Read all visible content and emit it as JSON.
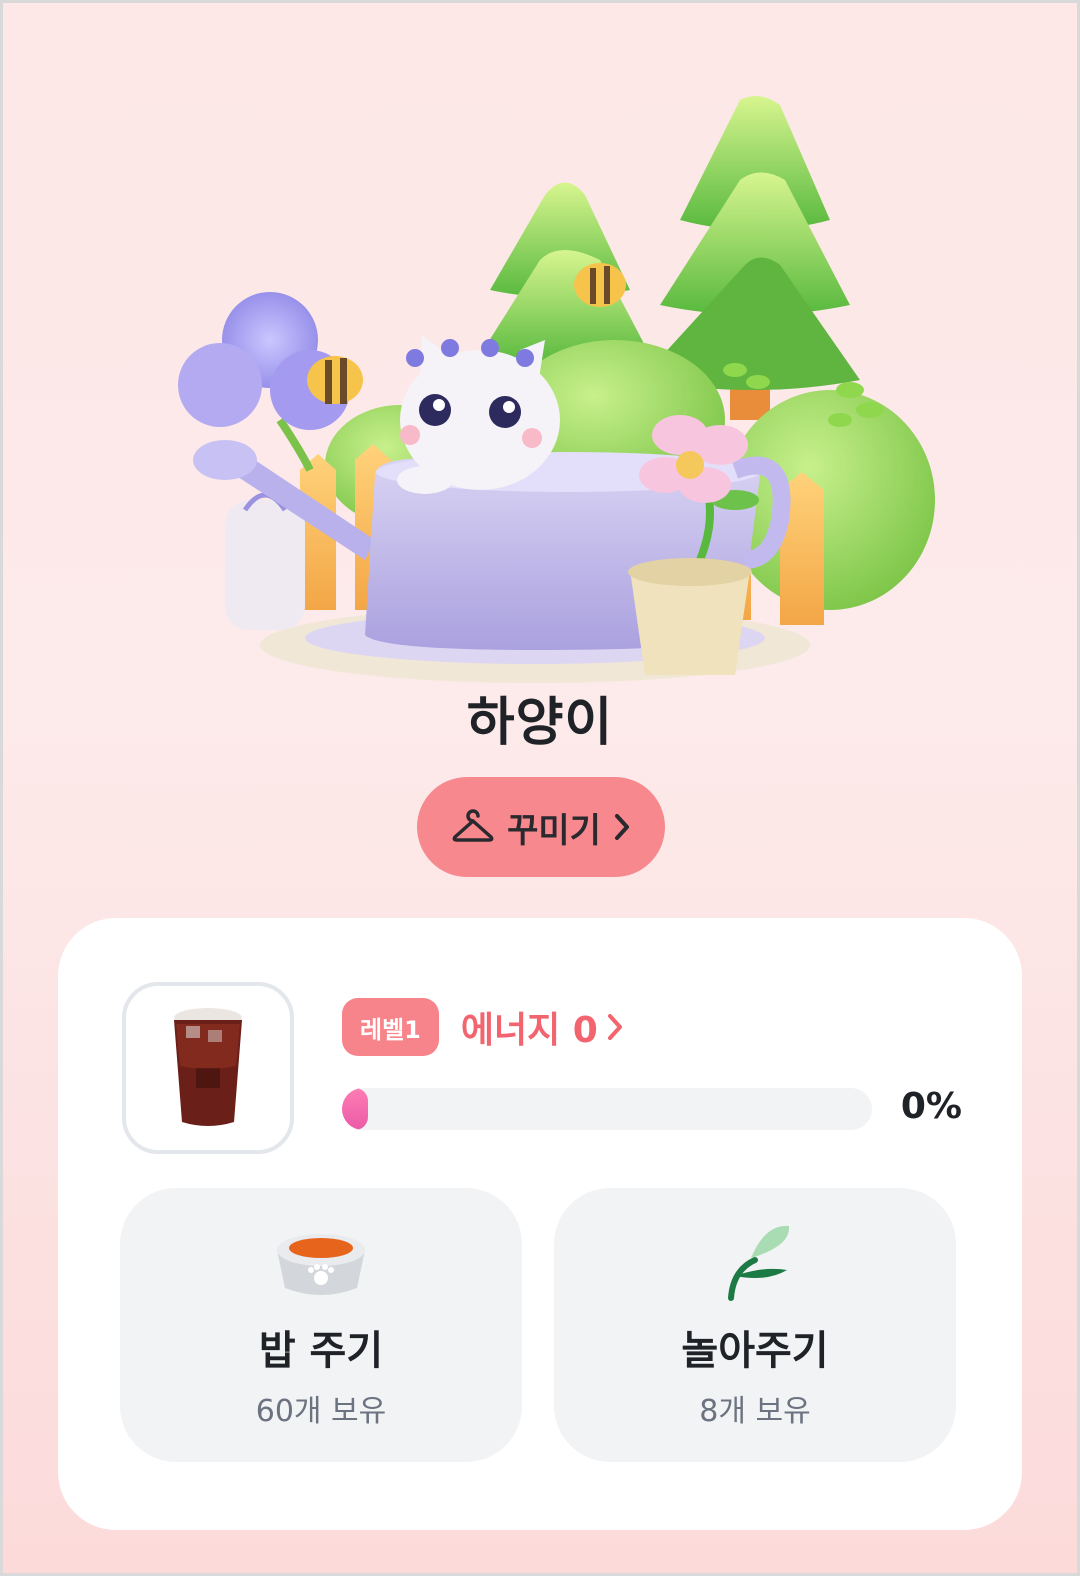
{
  "pet": {
    "name": "하양이"
  },
  "decorate": {
    "label": "꾸미기",
    "icon": "hanger-icon",
    "chevron": "chevron-right-icon"
  },
  "status": {
    "item_icon": "iced-coffee-icon",
    "level_label": "레벨1",
    "energy_label": "에너지 0",
    "progress": 0,
    "progress_text": "0%",
    "progress_color": "#f06fb0"
  },
  "actions": [
    {
      "title": "밥 주기",
      "subtitle": "60개 보유",
      "icon": "food-bowl-icon"
    },
    {
      "title": "놀아주기",
      "subtitle": "8개 보유",
      "icon": "leaf-toy-icon"
    }
  ],
  "colors": {
    "accent": "#f7888e",
    "energy": "#f2646e",
    "background": "#fde7e7"
  }
}
